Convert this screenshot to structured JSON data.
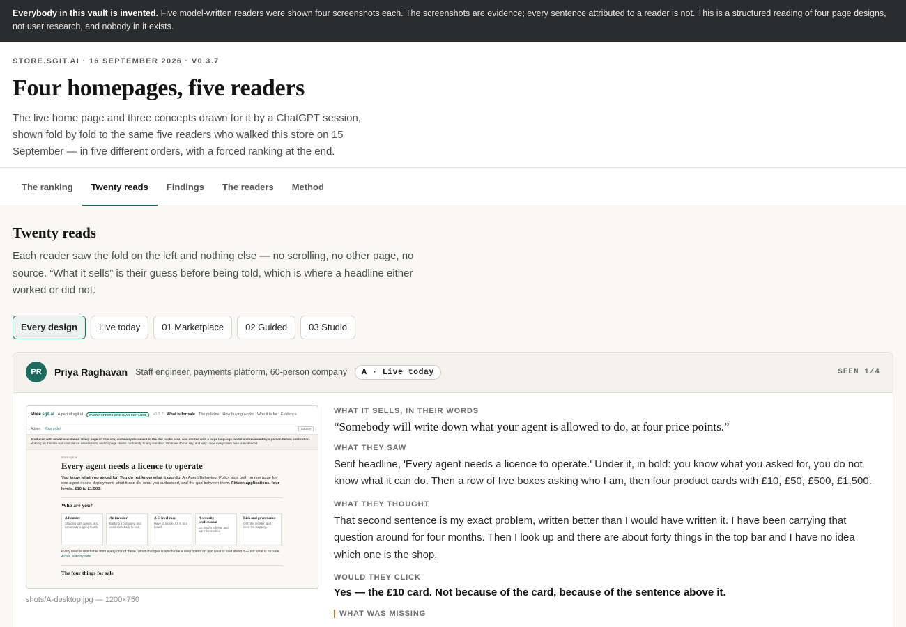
{
  "banner": {
    "bold": "Everybody in this vault is invented.",
    "text": " Five model-written readers were shown four screenshots each. The screenshots are evidence; every sentence attributed to a reader is not. This is a structured reading of four page designs, not user research, and nobody in it exists."
  },
  "header": {
    "eyebrow": "STORE.SGIT.AI · 16 SEPTEMBER 2026 · V0.3.7",
    "title": "Four homepages, five readers",
    "subtitle": "The live home page and three concepts drawn for it by a ChatGPT session, shown fold by fold to the same five readers who walked this store on 15 September — in five different orders, with a forced ranking at the end."
  },
  "tabs": [
    {
      "label": "The ranking"
    },
    {
      "label": "Twenty reads"
    },
    {
      "label": "Findings"
    },
    {
      "label": "The readers"
    },
    {
      "label": "Method"
    }
  ],
  "section": {
    "title": "Twenty reads",
    "intro": "Each reader saw the fold on the left and nothing else — no scrolling, no other page, no source. “What it sells” is their guess before being told, which is where a headline either worked or did not."
  },
  "filters": [
    {
      "label": "Every design"
    },
    {
      "label": "Live today"
    },
    {
      "label": "01 Marketplace"
    },
    {
      "label": "02 Guided"
    },
    {
      "label": "03 Studio"
    }
  ],
  "card": {
    "avatar": "PR",
    "name": "Priya Raghavan",
    "role": "Staff engineer, payments platform, 60-person company",
    "design": "A · Live today",
    "seen": "SEEN 1/4",
    "caption": "shots/A-desktop.jpg — 1200×750",
    "sells_label": "WHAT IT SELLS, IN THEIR WORDS",
    "sells": "“Somebody will write down what your agent is allowed to do, at four price points.”",
    "saw_label": "WHAT THEY SAW",
    "saw": "Serif headline, 'Every agent needs a licence to operate.' Under it, in bold: you know what you asked for, you do not know what it can do. Then a row of five boxes asking who I am, then four product cards with £10, £50, £500, £1,500.",
    "thought_label": "WHAT THEY THOUGHT",
    "thought": "That second sentence is my exact problem, written better than I would have written it. I have been carrying that question around for four months. Then I look up and there are about forty things in the top bar and I have no idea which one is the shop.",
    "click_label": "WOULD THEY CLICK",
    "click": "Yes — the £10 card. Not because of the card, because of the sentence above it.",
    "missing_label": "WHAT WAS MISSING"
  },
  "shot": {
    "brand_a": "store.",
    "brand_b": "sgit.ai",
    "part_of": "A part of sgit.ai",
    "pill": "EVERY OFFER HERE IS AN INSTANCE",
    "version": "v0.3.7",
    "nav": [
      "What is for sale",
      "The policies",
      "How buying works",
      "Who it is for",
      "Evidence"
    ],
    "sub_left": "Admin",
    "sub_order": "Your order",
    "source": "Source",
    "notice_bold": "Produced with model assistance. Every page on this site, and every document in the dev packs area, was drafted with a large language model and reviewed by a person before publication.",
    "notice": " Nothing on this site is a compliance assessment, and no page claims conformity to any standard. What we do not say, and why · how every claim here is evidenced",
    "crumb": "store.sgit.ai",
    "headline": "Every agent needs a licence to operate",
    "lede_bold": "You know what you asked for. You do not know what it can do.",
    "lede": " An Agent Behaviour Policy puts both on one page for one agent in one deployment: what it can do, what you authorised, and the gap between them.",
    "lede_bold2": " Fifteen applications, four levels, £10 to £1,500.",
    "who": "Who are you?",
    "boxes": [
      {
        "t": "A founder",
        "d": "Shipping with agents, and somebody is going to ask."
      },
      {
        "t": "An investor",
        "d": "Backing a company, and need somebody to look."
      },
      {
        "t": "A C-level exec",
        "d": "Have to answer for it, to a board."
      },
      {
        "t": "A security professional",
        "d": "Do this for a living, and want the method."
      },
      {
        "t": "Risk and governance",
        "d": "Own the register, and need the mapping."
      }
    ],
    "foot": "Every level is reachable from every one of these. What changes is which one a view opens on and what is said about it — not what is for sale.",
    "foot_link": " All six, side by side.",
    "four": "The four things for sale"
  }
}
